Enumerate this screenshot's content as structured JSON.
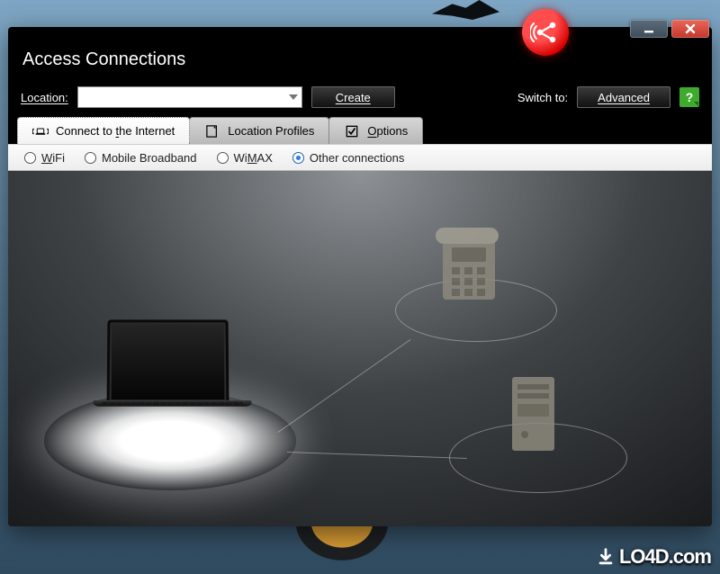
{
  "window": {
    "title": "Access Connections"
  },
  "toolbar": {
    "location_label": "Location:",
    "location_value": "",
    "create_label": "Create",
    "switch_label": "Switch to:",
    "advanced_label": "Advanced"
  },
  "tabs": {
    "connect": {
      "label": "Connect to the Internet"
    },
    "profiles": {
      "label": "Location Profiles"
    },
    "options": {
      "label": "Options"
    }
  },
  "radios": {
    "wifi": "WiFi",
    "mbb": "Mobile Broadband",
    "wimax": "WiMAX",
    "other": "Other connections",
    "selected": "other"
  },
  "help": {
    "glyph": "?"
  },
  "watermark": {
    "text": "LO4D.com"
  },
  "colors": {
    "beacon": "#d80000",
    "help": "#3eab2e",
    "close": "#c6362a"
  }
}
